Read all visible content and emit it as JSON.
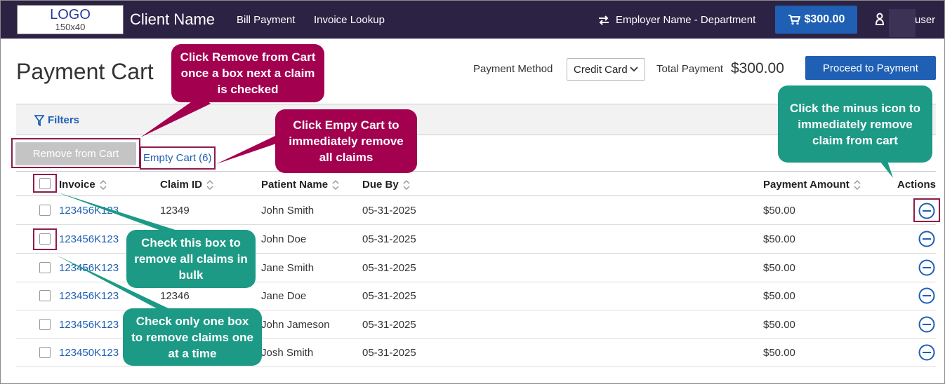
{
  "header": {
    "logo_line1": "LOGO",
    "logo_line2": "150x40",
    "client_name": "Client Name",
    "nav": [
      "Bill Payment",
      "Invoice Lookup"
    ],
    "employer": "Employer Name - Department",
    "cart_total": "$300.00",
    "user": "user"
  },
  "page": {
    "title": "Payment Cart",
    "payment_method_label": "Payment Method",
    "payment_method_value": "Credit Card",
    "total_label": "Total Payment",
    "total_value": "$300.00",
    "proceed_label": "Proceed to Payment",
    "filters_label": "Filters",
    "remove_label": "Remove from Cart",
    "empty_label": "Empty Cart (6)"
  },
  "table": {
    "columns": [
      "Invoice",
      "Claim ID",
      "Patient Name",
      "Due By",
      "Payment Amount",
      "Actions"
    ],
    "rows": [
      {
        "invoice": "123456K123",
        "claim": "12349",
        "patient": "John Smith",
        "due": "05-31-2025",
        "amount": "$50.00"
      },
      {
        "invoice": "123456K123",
        "claim": "",
        "patient": "John Doe",
        "due": "05-31-2025",
        "amount": "$50.00"
      },
      {
        "invoice": "123456K123",
        "claim": "",
        "patient": "Jane Smith",
        "due": "05-31-2025",
        "amount": "$50.00"
      },
      {
        "invoice": "123456K123",
        "claim": "12346",
        "patient": "Jane Doe",
        "due": "05-31-2025",
        "amount": "$50.00"
      },
      {
        "invoice": "123456K123",
        "claim": "",
        "patient": "John Jameson",
        "due": "05-31-2025",
        "amount": "$50.00"
      },
      {
        "invoice": "123450K123",
        "claim": "",
        "patient": "Josh Smith",
        "due": "05-31-2025",
        "amount": "$50.00"
      }
    ]
  },
  "callouts": {
    "remove": "Click Remove from Cart once a box next a claim is checked",
    "empty": "Click Empy Cart to immediately remove all claims",
    "minus": "Click the minus icon to immediately remove claim from cart",
    "bulk": "Check this box to remove all claims in bulk",
    "single": "Check only one box to remove claims one at a time"
  },
  "colors": {
    "header_bg": "#2c2244",
    "primary": "#1f5fb4",
    "callout_magenta": "#a3004f",
    "callout_teal": "#1c9a85",
    "highlight": "#8c1d4c"
  }
}
